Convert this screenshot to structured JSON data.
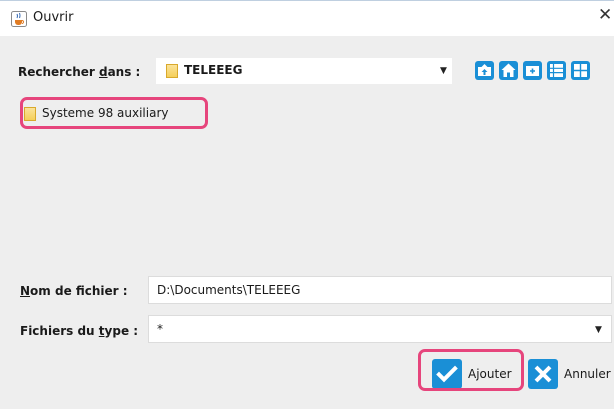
{
  "window": {
    "title": "Ouvrir",
    "app_icon": "java-cup-icon",
    "close_icon": "close-icon",
    "close_glyph": "✕"
  },
  "look_in": {
    "label_prefix": "Rechercher ",
    "label_mnemonic": "d",
    "label_suffix": "ans :",
    "value": "TELEEEG",
    "value_icon": "folder-icon",
    "dropdown_icon": "chevron-down-icon",
    "dropdown_glyph": "▼"
  },
  "toolbar": {
    "buttons": [
      {
        "name": "up-one-level-button",
        "icon": "up-folder-icon"
      },
      {
        "name": "home-button",
        "icon": "home-icon"
      },
      {
        "name": "new-folder-button",
        "icon": "new-folder-icon"
      },
      {
        "name": "list-view-button",
        "icon": "list-icon"
      },
      {
        "name": "details-view-button",
        "icon": "grid-icon"
      }
    ],
    "accent_color": "#1a8fd6"
  },
  "file_list": {
    "items": [
      {
        "name": "Systeme 98 auxiliary",
        "type": "folder",
        "highlighted": true
      }
    ]
  },
  "file_name": {
    "label_prefix": "",
    "label_mnemonic": "N",
    "label_suffix": "om de fichier :",
    "value": "D:\\Documents\\TELEEEG"
  },
  "file_type": {
    "label_prefix": "Fichiers du ",
    "label_mnemonic": "t",
    "label_suffix": "ype :",
    "value": "*",
    "dropdown_glyph": "▼"
  },
  "buttons": {
    "add_label": "Ajouter",
    "add_icon": "checkmark-icon",
    "cancel_label": "Annuler",
    "cancel_icon": "x-icon"
  },
  "colors": {
    "highlight": "#e6457c",
    "folder": "#f5cf5a",
    "dialog_bg": "#eeeeee"
  }
}
